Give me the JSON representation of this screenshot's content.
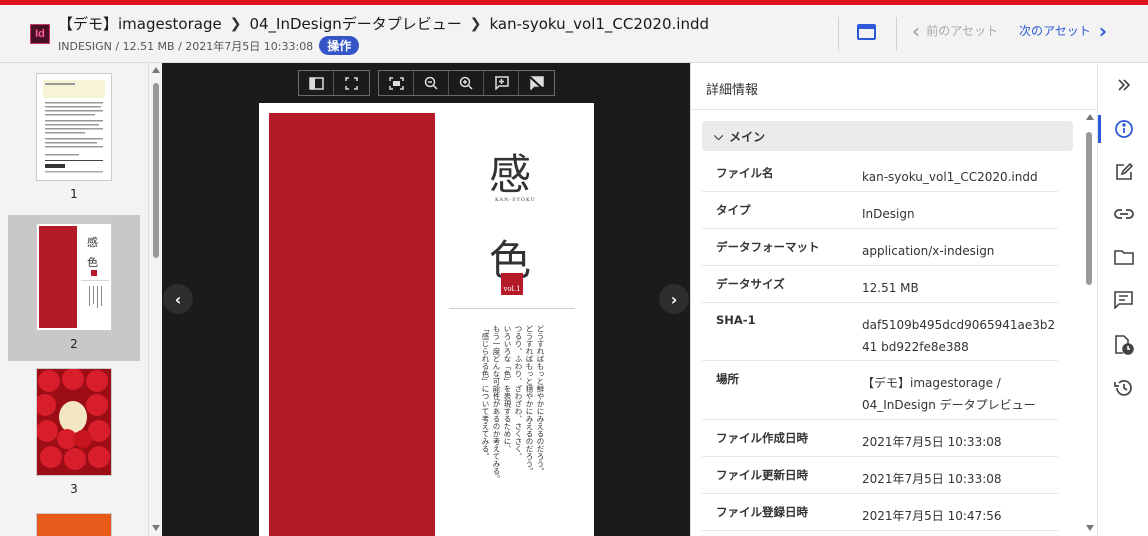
{
  "header": {
    "app_badge": "Id",
    "breadcrumb": [
      "【デモ】imagestorage",
      "04_InDesignデータプレビュー",
      "kan-syoku_vol1_CC2020.indd"
    ],
    "meta": "INDESIGN / 12.51 MB / 2021年7月5日 10:33:08",
    "ops_label": "操作",
    "prev_asset": "前のアセット",
    "next_asset": "次のアセット",
    "accent_color": "#e0141e",
    "link_color": "#2d5bd8"
  },
  "thumbnails": [
    {
      "number": "1",
      "selected": false
    },
    {
      "number": "2",
      "selected": true
    },
    {
      "number": "3",
      "selected": false
    }
  ],
  "viewer": {
    "toolbar_icons": [
      "sidebar-toggle-icon",
      "fullscreen-icon",
      "fit-page-icon",
      "zoom-out-icon",
      "zoom-in-icon",
      "add-comment-icon",
      "hide-comments-icon"
    ],
    "page": {
      "kanji_top": "感",
      "subtitle": "KAN-SYOKU",
      "kanji_bottom": "色",
      "vol": "vol.1",
      "vertical_lines": [
        "どうすればもっと鮮やかにみえるのだろう。",
        "どうすればもっと穏やかにみえるのだろう。",
        "つるり、ふわり、ざわざわ、さくさく、",
        "いろいろな「色」を表現するために、",
        "もう一度どんな可能性があるのか考えてみる。",
        "「感じられる色」について考えてみる。"
      ]
    }
  },
  "details": {
    "title": "詳細情報",
    "section": "メイン",
    "rows": [
      {
        "key": "ファイル名",
        "value": "kan-syoku_vol1_CC2020.indd"
      },
      {
        "key": "タイプ",
        "value": "InDesign"
      },
      {
        "key": "データフォーマット",
        "value": "application/x-indesign"
      },
      {
        "key": "データサイズ",
        "value": "12.51 MB"
      },
      {
        "key": "SHA-1",
        "value": "daf5109b495dcd9065941ae3b241 bd922fe8e388"
      },
      {
        "key": "場所",
        "value": "【デモ】imagestorage / 04_InDesign データプレビュー"
      },
      {
        "key": "ファイル作成日時",
        "value": "2021年7月5日 10:33:08"
      },
      {
        "key": "ファイル更新日時",
        "value": "2021年7月5日 10:33:08"
      },
      {
        "key": "ファイル登録日時",
        "value": "2021年7月5日 10:47:56"
      }
    ]
  },
  "rail_icons": [
    "collapse-panel-icon",
    "info-icon",
    "edit-icon",
    "link-icon",
    "folder-icon",
    "comment-icon",
    "file-history-icon",
    "history-icon"
  ]
}
